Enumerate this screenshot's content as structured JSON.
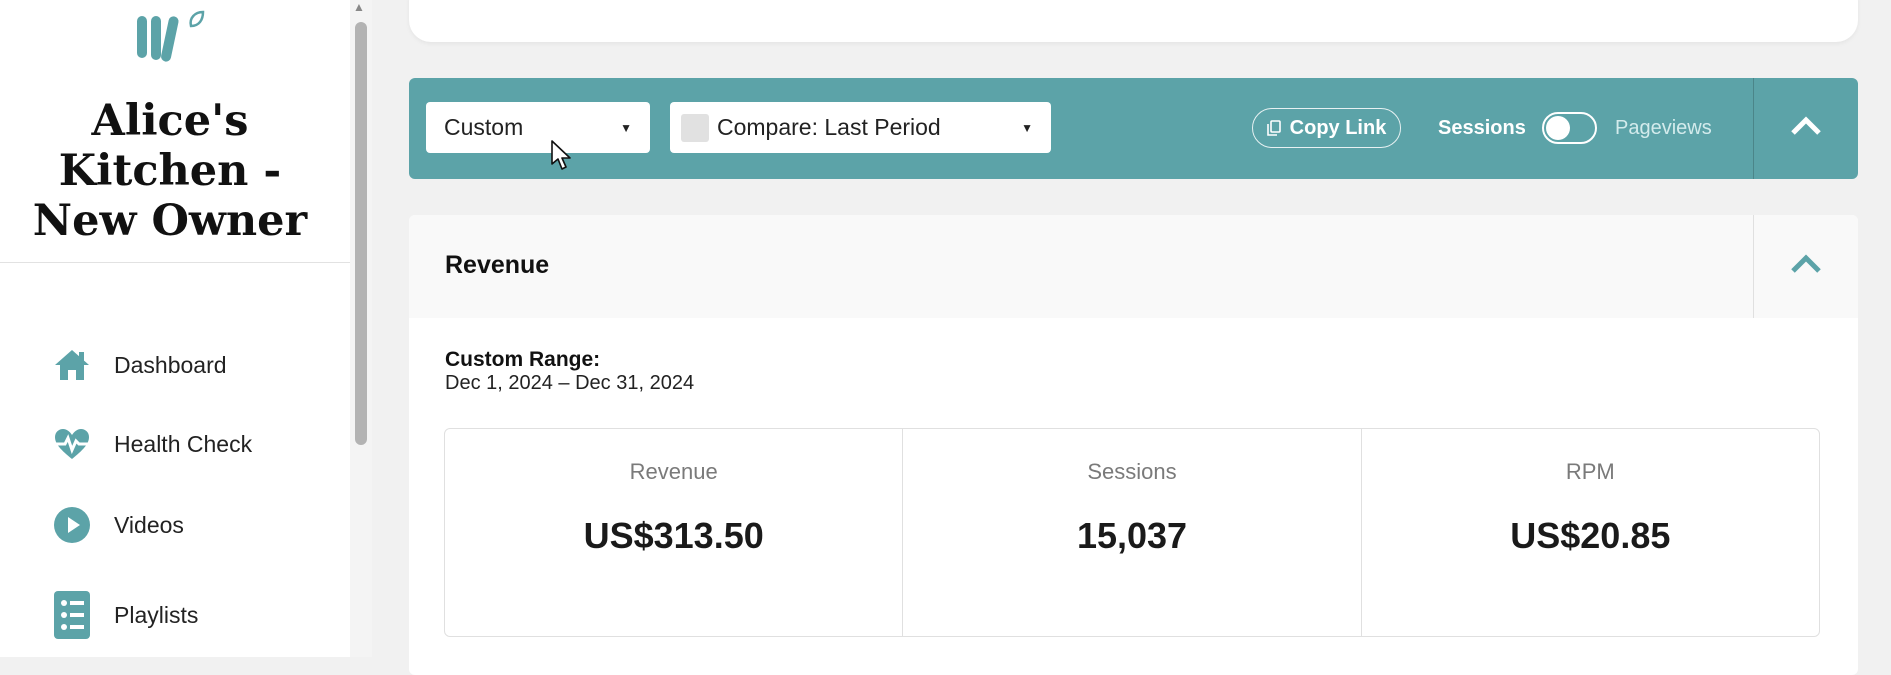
{
  "brand": {
    "title": "Alice's Kitchen - New Owner",
    "accent_color": "#5ca3a8"
  },
  "sidebar": {
    "items": [
      {
        "label": "Dashboard",
        "icon": "home-icon"
      },
      {
        "label": "Health Check",
        "icon": "heartbeat-icon"
      },
      {
        "label": "Videos",
        "icon": "play-circle-icon"
      },
      {
        "label": "Playlists",
        "icon": "checklist-icon"
      }
    ]
  },
  "filters": {
    "range_select": "Custom",
    "compare_select": "Compare: Last Period",
    "copy_link": "Copy Link",
    "toggle": {
      "left": "Sessions",
      "right": "Pageviews",
      "state": "Sessions"
    }
  },
  "revenue": {
    "title": "Revenue",
    "range_label": "Custom Range:",
    "range_value": "Dec 1, 2024 – Dec 31, 2024",
    "metrics": [
      {
        "label": "Revenue",
        "value": "US$313.50"
      },
      {
        "label": "Sessions",
        "value": "15,037"
      },
      {
        "label": "RPM",
        "value": "US$20.85"
      }
    ]
  }
}
